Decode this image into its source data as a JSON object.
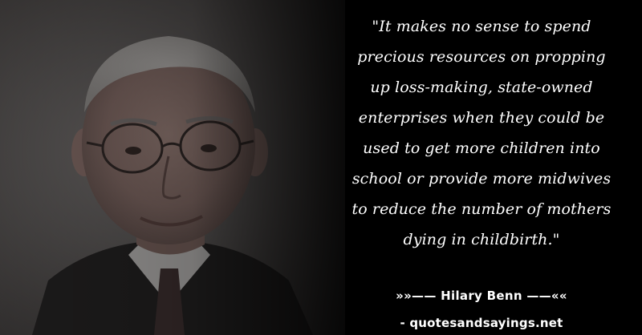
{
  "quote": {
    "text": "\"It makes no sense to spend\nprecious resources on propping\nup loss-making, state-owned\nenterprises when they could be\nused to get more children into\nschool or provide more midwives\nto reduce the number of mothers\ndying in childbirth.\""
  },
  "attribution": {
    "author_line": "»»—— Hilary Benn ——««",
    "site": "- quotesandsayings.net"
  },
  "colors": {
    "text": "#ffffff",
    "background": "#000000"
  }
}
